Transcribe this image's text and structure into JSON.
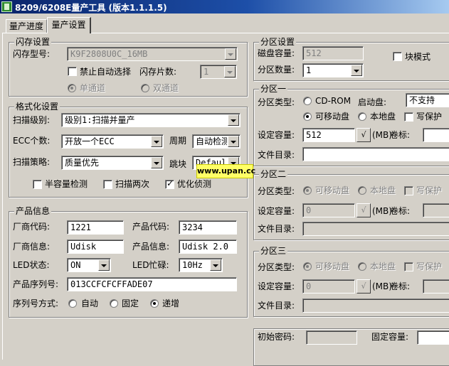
{
  "window": {
    "title": "8209/6208E量产工具 (版本1.1.1.5)"
  },
  "tabs": [
    {
      "label": "量产进度"
    },
    {
      "label": "量产设置"
    }
  ],
  "flash": {
    "group_label": "闪存设置",
    "type_label": "闪存型号:",
    "type_value": "K9F2808U0C_16MB",
    "disable_auto_label": "禁止自动选择",
    "chips_label": "闪存片数:",
    "chips_value": "1",
    "single_channel": "单通道",
    "dual_channel": "双通道"
  },
  "format": {
    "group_label": "格式化设置",
    "scan_level_label": "扫描级别:",
    "scan_level_value": "级别1:扫描并量产",
    "ecc_label": "ECC个数:",
    "ecc_value": "开放一个ECC",
    "period_label": "周期",
    "period_value": "自动检测",
    "strategy_label": "扫描策略:",
    "strategy_value": "质量优先",
    "jump_label": "跳块",
    "jump_value": "Default",
    "half_capacity": "半容量检测",
    "scan_twice": "扫描两次",
    "optimize": "优化侦测"
  },
  "product": {
    "group_label": "产品信息",
    "vendor_code_label": "厂商代码:",
    "vendor_code": "1221",
    "product_code_label": "产品代码:",
    "product_code": "3234",
    "vendor_info_label": "厂商信息:",
    "vendor_info": "Udisk",
    "product_info_label": "产品信息:",
    "product_info": "Udisk 2.0",
    "led_state_label": "LED状态:",
    "led_state": "ON",
    "led_busy_label": "LED忙碌:",
    "led_busy": "10Hz",
    "serial_label": "产品序列号:",
    "serial": "013CCFCFCFFADE07",
    "serial_mode_label": "序列号方式:",
    "serial_auto": "自动",
    "serial_fixed": "固定",
    "serial_increment": "递增"
  },
  "partition": {
    "group_label": "分区设置",
    "disk_capacity_label": "磁盘容量:",
    "disk_capacity": "512",
    "block_mode": "块模式",
    "count_label": "分区数量:",
    "count_value": "1"
  },
  "part1": {
    "group_label": "分区一",
    "type_label": "分区类型:",
    "cdrom": "CD-ROM",
    "boot_label": "启动盘:",
    "boot_value": "不支持",
    "removable": "可移动盘",
    "local": "本地盘",
    "write_protect": "写保护",
    "capacity_label": "设定容量:",
    "capacity": "512",
    "check_btn": "√",
    "mb_label": "(MB)",
    "volume_label": "卷标:",
    "dir_label": "文件目录:"
  },
  "part2": {
    "group_label": "分区二",
    "type_label": "分区类型:",
    "removable": "可移动盘",
    "local": "本地盘",
    "write_protect": "写保护",
    "capacity_label": "设定容量:",
    "capacity": "0",
    "check_btn": "√",
    "mb_label": "(MB)",
    "volume_label": "卷标:",
    "dir_label": "文件目录:"
  },
  "part3": {
    "group_label": "分区三",
    "type_label": "分区类型:",
    "removable": "可移动盘",
    "local": "本地盘",
    "write_protect": "写保护",
    "capacity_label": "设定容量:",
    "capacity": "0",
    "check_btn": "√",
    "mb_label": "(MB)",
    "volume_label": "卷标:",
    "dir_label": "文件目录:"
  },
  "password": {
    "initial_label": "初始密码:",
    "fixed_capacity_label": "固定容量:"
  },
  "watermark": {
    "text": "www.upan.cc"
  }
}
